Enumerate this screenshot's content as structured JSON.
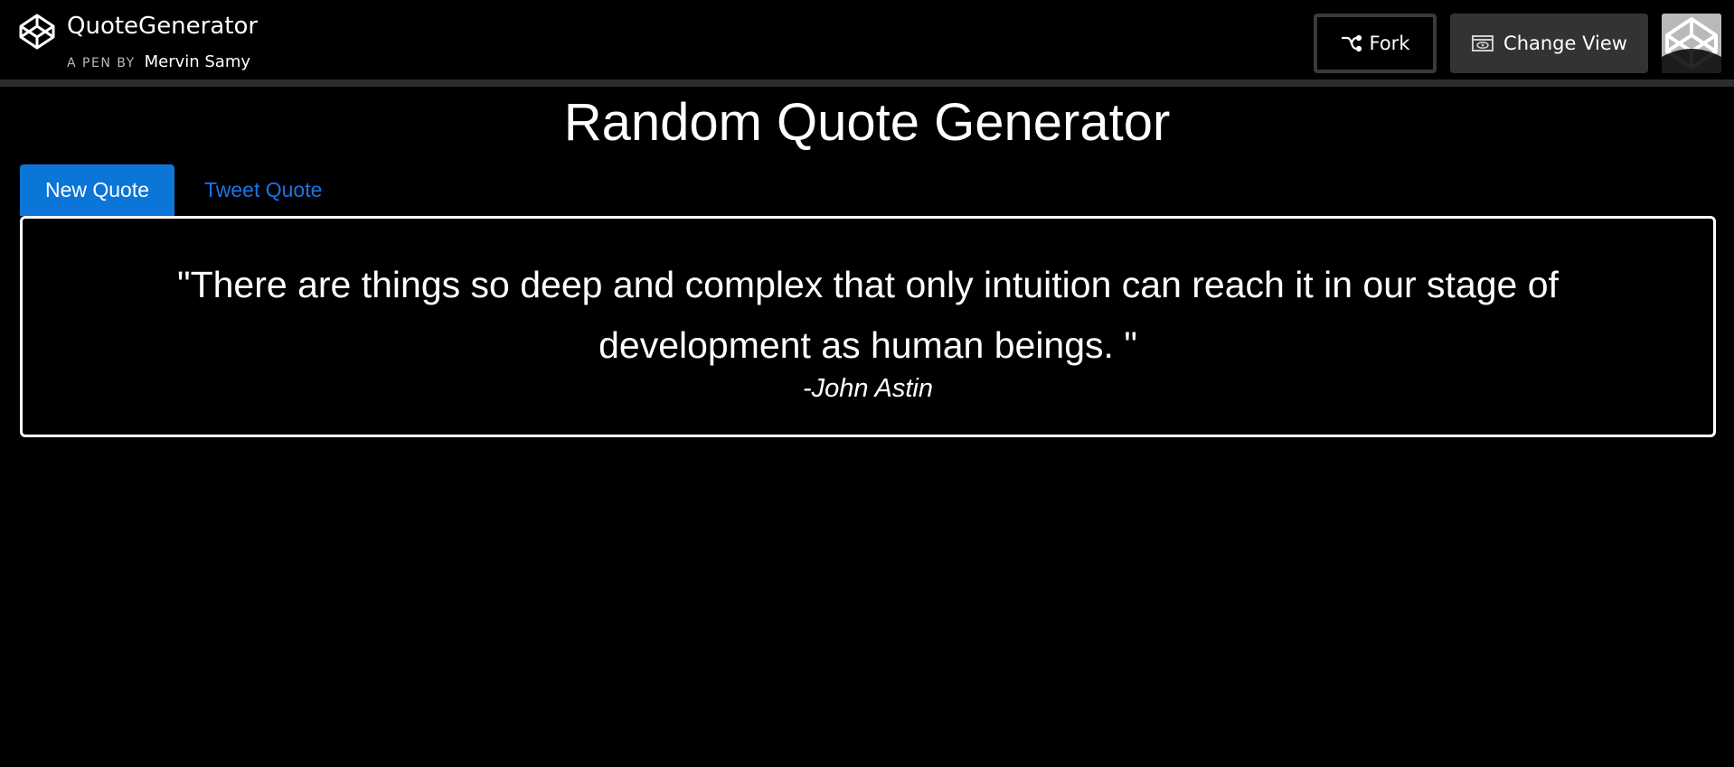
{
  "header": {
    "pen_title": "QuoteGenerator",
    "pen_by_label": "A PEN BY",
    "author": "Mervin Samy",
    "fork_label": "Fork",
    "change_view_label": "Change View",
    "icons": {
      "logo": "codepen-logo-icon",
      "fork": "fork-icon",
      "change_view": "eye-icon",
      "avatar": "codepen-avatar-icon"
    }
  },
  "main": {
    "title": "Random Quote Generator",
    "tabs": [
      {
        "label": "New Quote",
        "active": true
      },
      {
        "label": "Tweet Quote",
        "active": false
      }
    ],
    "quote": {
      "text": "\"There are things so deep and complex that only intuition can reach it in our stage of development as human beings. \"",
      "author": "-John Astin"
    }
  },
  "colors": {
    "background": "#000000",
    "primary_button": "#0b75d8",
    "link": "#1a73e8",
    "header_divider": "#2d2d2f",
    "change_view_bg": "#333336"
  }
}
